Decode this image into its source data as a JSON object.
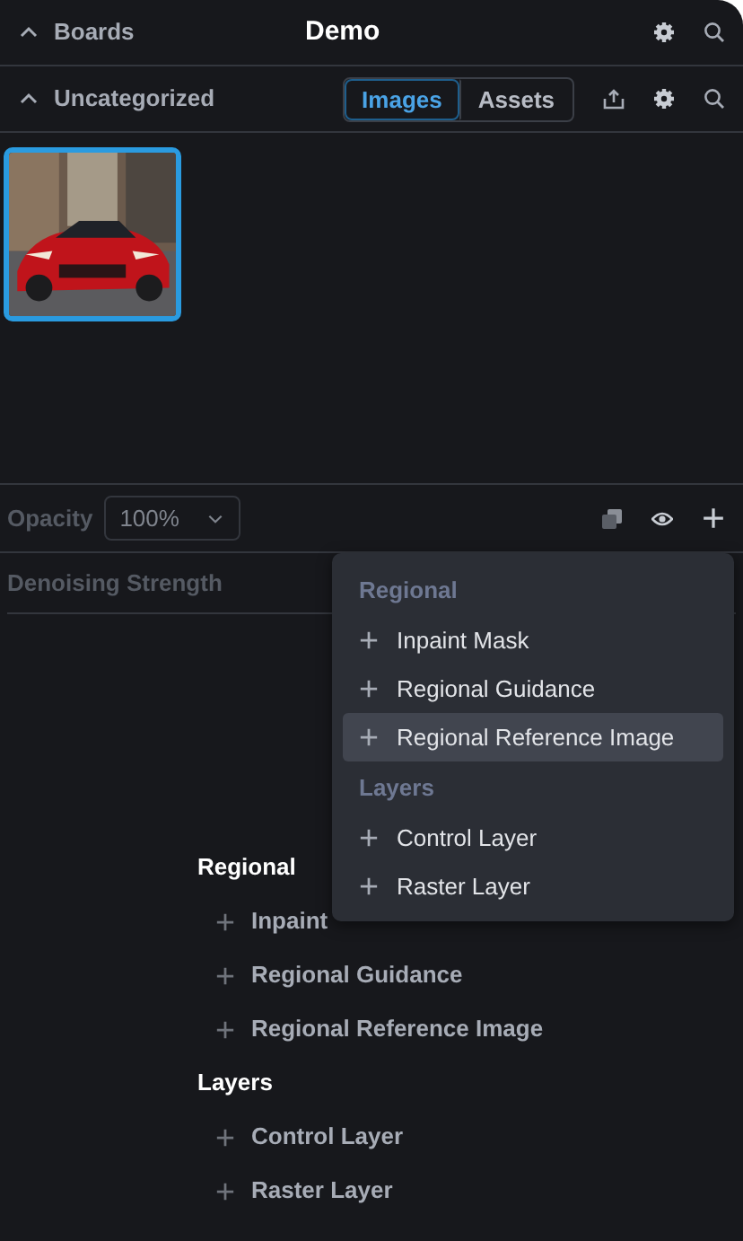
{
  "boards_header": {
    "label": "Boards",
    "expanded": true,
    "title": "Demo"
  },
  "gallery_header": {
    "label": "Uncategorized",
    "expanded": true
  },
  "gallery_tabs": [
    {
      "label": "Images",
      "selected": true
    },
    {
      "label": "Assets",
      "selected": false
    }
  ],
  "gallery": [
    {
      "kind": "picture",
      "selected": true
    }
  ],
  "layer_toolbar": {
    "opacity_label": "Opacity",
    "opacity_value": "100%"
  },
  "denoising": {
    "label": "Denoising Strength"
  },
  "add_list": [
    {
      "heading": "Regional",
      "items": [
        "Inpaint",
        "Regional Guidance",
        "Regional Reference Image"
      ]
    },
    {
      "heading": "Layers",
      "items": [
        "Control Layer",
        "Raster Layer"
      ]
    }
  ],
  "add_menu": [
    {
      "heading": "Regional",
      "items": [
        {
          "label": "Inpaint Mask",
          "selected": false
        },
        {
          "label": "Regional Guidance",
          "selected": false
        },
        {
          "label": "Regional Reference Image",
          "selected": true
        }
      ]
    },
    {
      "heading": "Layers",
      "items": [
        {
          "label": "Control Layer",
          "selected": false
        },
        {
          "label": "Raster Layer",
          "selected": false
        }
      ]
    }
  ]
}
